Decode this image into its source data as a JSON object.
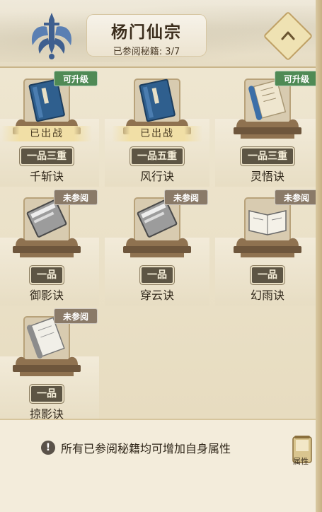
{
  "header": {
    "title": "杨门仙宗",
    "progress": "已参阅秘籍: 3/7",
    "emblem_icon": "sword-wings-emblem-icon",
    "collapse_icon": "chevron-up-icon"
  },
  "colors": {
    "upgrade_tag": "#4f8a55",
    "unread_tag": "#8a7a68",
    "grade_plate": "#5d5544"
  },
  "books": [
    {
      "name": "千斩诀",
      "grade": "一品三重",
      "tag": "可升级",
      "equipped": "已出战",
      "art": "blue-book-icon"
    },
    {
      "name": "风行诀",
      "grade": "一品五重",
      "tag": "",
      "equipped": "已出战",
      "art": "blue-book-icon"
    },
    {
      "name": "灵悟诀",
      "grade": "一品三重",
      "tag": "可升级",
      "equipped": "",
      "art": "scroll-icon"
    },
    {
      "name": "御影诀",
      "grade": "一品",
      "tag": "未参阅",
      "equipped": "",
      "art": "grey-book-icon"
    },
    {
      "name": "穿云诀",
      "grade": "一品",
      "tag": "未参阅",
      "equipped": "",
      "art": "grey-book-icon"
    },
    {
      "name": "幻雨诀",
      "grade": "一品",
      "tag": "未参阅",
      "equipped": "",
      "art": "open-book-icon"
    },
    {
      "name": "掠影诀",
      "grade": "一品",
      "tag": "未参阅",
      "equipped": "",
      "art": "grey-scroll-icon"
    }
  ],
  "footer": {
    "hint": "所有已参阅秘籍均可增加自身属性",
    "attr_button": "属性"
  }
}
